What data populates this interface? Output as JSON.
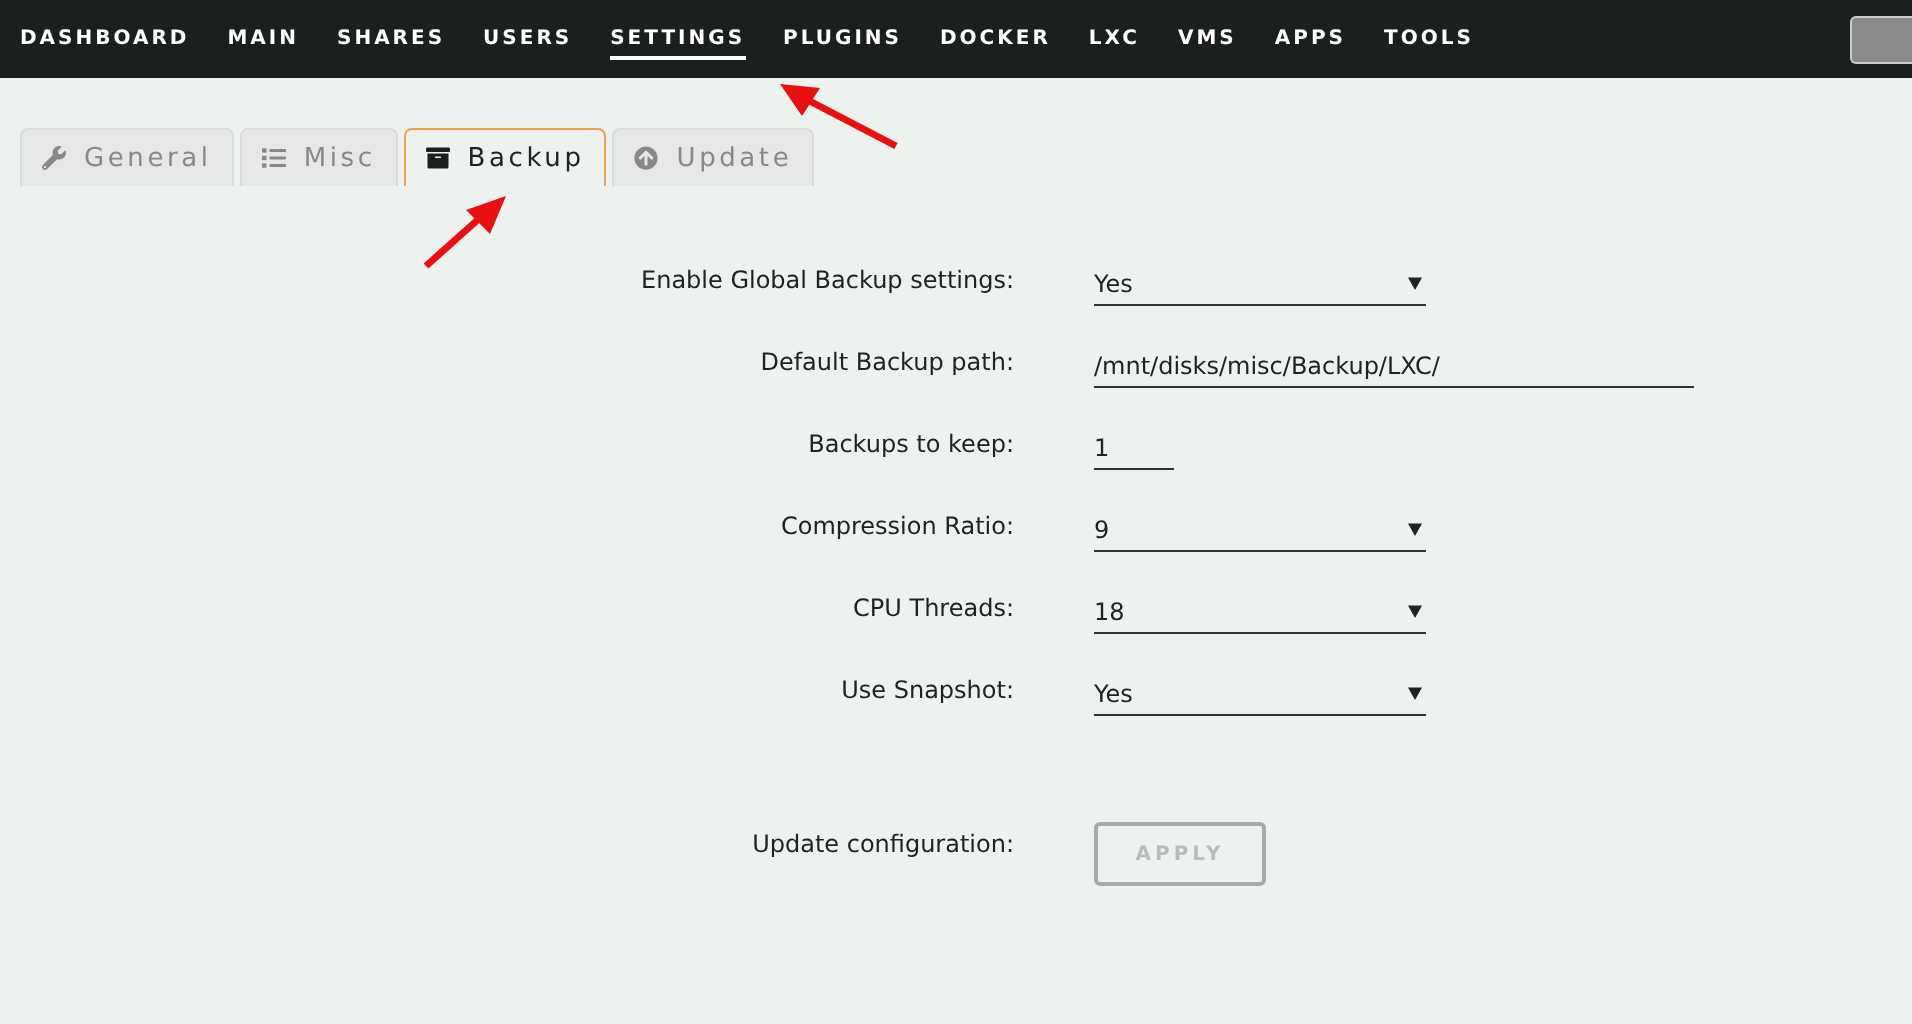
{
  "nav": {
    "items": [
      {
        "label": "DASHBOARD",
        "selected": false
      },
      {
        "label": "MAIN",
        "selected": false
      },
      {
        "label": "SHARES",
        "selected": false
      },
      {
        "label": "USERS",
        "selected": false
      },
      {
        "label": "SETTINGS",
        "selected": true
      },
      {
        "label": "PLUGINS",
        "selected": false
      },
      {
        "label": "DOCKER",
        "selected": false
      },
      {
        "label": "LXC",
        "selected": false
      },
      {
        "label": "VMS",
        "selected": false
      },
      {
        "label": "APPS",
        "selected": false
      },
      {
        "label": "TOOLS",
        "selected": false
      }
    ]
  },
  "tabs": [
    {
      "label": "General",
      "selected": false
    },
    {
      "label": "Misc",
      "selected": false
    },
    {
      "label": "Backup",
      "selected": true
    },
    {
      "label": "Update",
      "selected": false
    }
  ],
  "settings": [
    {
      "label": "Enable Global Backup settings:",
      "kind": "select",
      "value": "Yes"
    },
    {
      "label": "Default Backup path:",
      "kind": "text",
      "value": "/mnt/disks/misc/Backup/LXC/"
    },
    {
      "label": "Backups to keep:",
      "kind": "text",
      "value": "1"
    },
    {
      "label": "Compression Ratio:",
      "kind": "select",
      "value": "9"
    },
    {
      "label": "CPU Threads:",
      "kind": "select",
      "value": "18"
    },
    {
      "label": "Use Snapshot:",
      "kind": "select",
      "value": "Yes"
    }
  ],
  "apply": {
    "label": "Update configuration:",
    "button": "APPLY",
    "disabled": true
  }
}
